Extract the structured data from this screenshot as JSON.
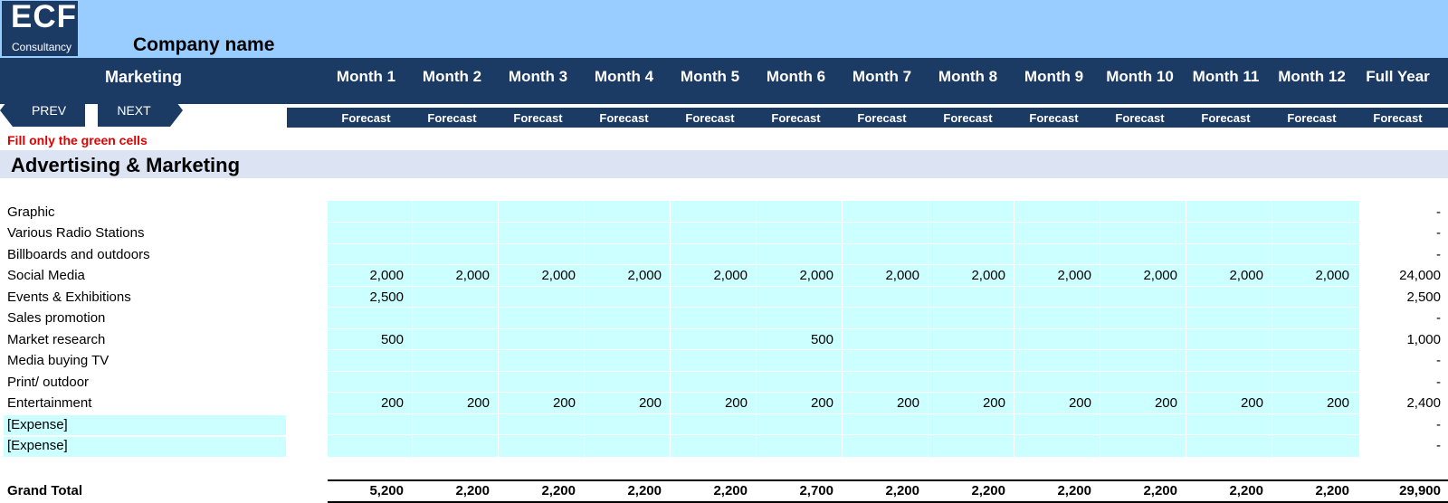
{
  "brand": {
    "logo_main": "ECF",
    "logo_sub": "Consultancy",
    "company_name": "Company name"
  },
  "header": {
    "title": "Marketing",
    "months": [
      "Month 1",
      "Month 2",
      "Month 3",
      "Month 4",
      "Month 5",
      "Month 6",
      "Month 7",
      "Month 8",
      "Month 9",
      "Month 10",
      "Month 11",
      "Month 12",
      "Full Year"
    ],
    "forecast_label": "Forecast"
  },
  "nav": {
    "prev": "PREV",
    "next": "NEXT"
  },
  "note": "Fill only the green cells",
  "section": {
    "title": "Advertising & Marketing"
  },
  "rows": [
    {
      "label": "Graphic",
      "values": [
        "",
        "",
        "",
        "",
        "",
        "",
        "",
        "",
        "",
        "",
        "",
        ""
      ],
      "full_year": "-"
    },
    {
      "label": "Various Radio Stations",
      "values": [
        "",
        "",
        "",
        "",
        "",
        "",
        "",
        "",
        "",
        "",
        "",
        ""
      ],
      "full_year": "-"
    },
    {
      "label": "Billboards and outdoors",
      "values": [
        "",
        "",
        "",
        "",
        "",
        "",
        "",
        "",
        "",
        "",
        "",
        ""
      ],
      "full_year": "-"
    },
    {
      "label": "Social Media",
      "values": [
        "2,000",
        "2,000",
        "2,000",
        "2,000",
        "2,000",
        "2,000",
        "2,000",
        "2,000",
        "2,000",
        "2,000",
        "2,000",
        "2,000"
      ],
      "full_year": "24,000"
    },
    {
      "label": "Events & Exhibitions",
      "values": [
        "2,500",
        "",
        "",
        "",
        "",
        "",
        "",
        "",
        "",
        "",
        "",
        ""
      ],
      "full_year": "2,500"
    },
    {
      "label": "Sales promotion",
      "values": [
        "",
        "",
        "",
        "",
        "",
        "",
        "",
        "",
        "",
        "",
        "",
        ""
      ],
      "full_year": "-"
    },
    {
      "label": "Market research",
      "values": [
        "500",
        "",
        "",
        "",
        "",
        "500",
        "",
        "",
        "",
        "",
        "",
        ""
      ],
      "full_year": "1,000"
    },
    {
      "label": "Media buying TV",
      "values": [
        "",
        "",
        "",
        "",
        "",
        "",
        "",
        "",
        "",
        "",
        "",
        ""
      ],
      "full_year": "-"
    },
    {
      "label": "Print/ outdoor",
      "values": [
        "",
        "",
        "",
        "",
        "",
        "",
        "",
        "",
        "",
        "",
        "",
        ""
      ],
      "full_year": "-"
    },
    {
      "label": "Entertainment",
      "values": [
        "200",
        "200",
        "200",
        "200",
        "200",
        "200",
        "200",
        "200",
        "200",
        "200",
        "200",
        "200"
      ],
      "full_year": "2,400"
    },
    {
      "label": "[Expense]",
      "values": [
        "",
        "",
        "",
        "",
        "",
        "",
        "",
        "",
        "",
        "",
        "",
        ""
      ],
      "full_year": "-"
    },
    {
      "label": "[Expense]",
      "values": [
        "",
        "",
        "",
        "",
        "",
        "",
        "",
        "",
        "",
        "",
        "",
        ""
      ],
      "full_year": "-"
    }
  ],
  "grand_total": {
    "label": "Grand Total",
    "values": [
      "5,200",
      "2,200",
      "2,200",
      "2,200",
      "2,200",
      "2,700",
      "2,200",
      "2,200",
      "2,200",
      "2,200",
      "2,200",
      "2,200"
    ],
    "full_year": "29,900"
  },
  "colors": {
    "navy": "#1b3a64",
    "sky": "#99ccff",
    "input_cell": "#ccffff",
    "section_band": "#dce3f2",
    "note_red": "#e00000"
  }
}
